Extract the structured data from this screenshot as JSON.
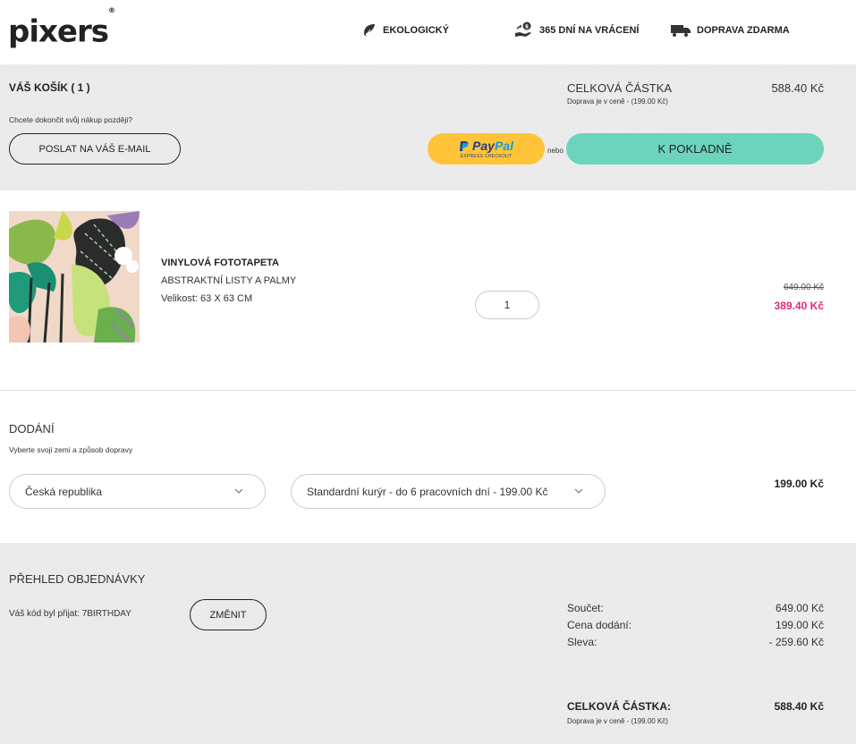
{
  "header": {
    "logo": "pixers",
    "logo_mark": "®",
    "features": [
      {
        "label": "EKOLOGICKÝ",
        "icon": "leaf-icon"
      },
      {
        "label": "365 DNÍ NA VRÁCENÍ",
        "icon": "money-return-icon"
      },
      {
        "label": "DOPRAVA ZDARMA",
        "icon": "truck-icon"
      }
    ]
  },
  "cart": {
    "title": "VÁŠ KOŠÍK ( 1 )",
    "save_later_text": "Chcete dokončit svůj nákup později?",
    "email_button": "POSLAT NA VÁŠ E-MAIL",
    "total_label": "CELKOVÁ ČÁSTKA",
    "total_value": "588.40 Kč",
    "shipping_note": "Doprava je v ceně - (199.00 Kč)",
    "paypal_label": "PayPal",
    "paypal_pay": "Pay",
    "paypal_pal": "Pal",
    "paypal_sub": "EXPRESS CHECKOUT",
    "or_text": "nebo",
    "checkout_button": "K POKLADNĚ"
  },
  "product": {
    "type": "VINYLOVÁ FOTOTAPETA",
    "name": "ABSTRAKTNÍ LISTY A PALMY",
    "size": "Velikost: 63 X 63 CM",
    "quantity": "1",
    "old_price": "649.00 Kč",
    "new_price": "389.40 Kč"
  },
  "delivery": {
    "title": "DODÁNÍ",
    "subtitle": "Vyberte svoji zemi a způsob dopravy",
    "country": "Česká republika",
    "method": "Standardní kurýr - do 6 pracovních dní - 199.00 Kč",
    "price": "199.00 Kč"
  },
  "summary": {
    "title": "PŘEHLED OBJEDNÁVKY",
    "code_text": "Váš kód byl přijat: 7BIRTHDAY",
    "change_button": "ZMĚNIT",
    "rows": [
      {
        "label": "Součet:",
        "value": "649.00 Kč"
      },
      {
        "label": "Cena dodání:",
        "value": "199.00 Kč"
      },
      {
        "label": "Sleva:",
        "value": "- 259.60 Kč"
      }
    ],
    "final_label": "CELKOVÁ ČÁSTKA:",
    "final_value": "588.40 Kč",
    "final_note": "Doprava je v ceně - (199.00 Kč)"
  },
  "colors": {
    "accent": "#6cd4bd",
    "paypal": "#ffc439",
    "sale_price": "#e6247c",
    "section_gray": "#e9e9e9"
  }
}
